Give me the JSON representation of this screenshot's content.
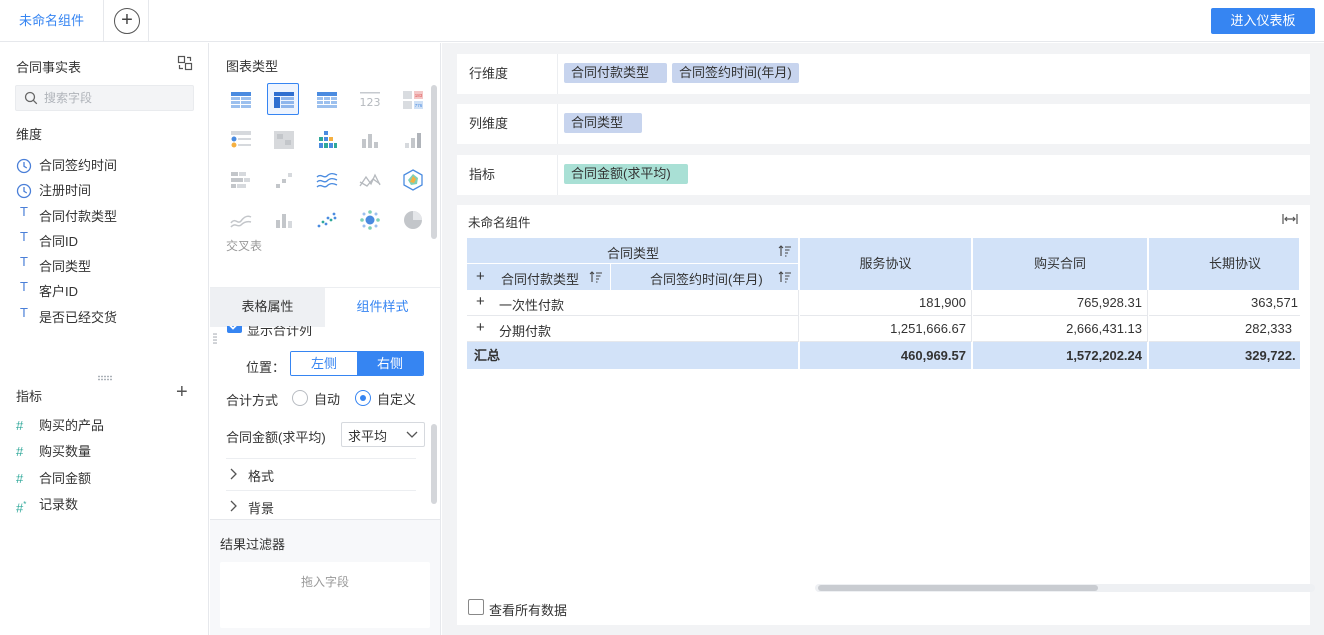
{
  "topbar": {
    "active_tab": "未命名组件",
    "add_tab": "+",
    "enter_dashboard": "进入仪表板"
  },
  "left_panel": {
    "dataset_title": "合同事实表",
    "search_placeholder": "搜索字段",
    "dimension_title": "维度",
    "dimensions": [
      {
        "icon": "clock-icon",
        "label": "合同签约时间"
      },
      {
        "icon": "clock-icon",
        "label": "注册时间"
      },
      {
        "icon": "text-type-icon",
        "label": "合同付款类型"
      },
      {
        "icon": "text-type-icon",
        "label": "合同ID"
      },
      {
        "icon": "text-type-icon",
        "label": "合同类型"
      },
      {
        "icon": "text-type-icon",
        "label": "客户ID"
      },
      {
        "icon": "text-type-icon",
        "label": "是否已经交货"
      }
    ],
    "metric_title": "指标",
    "metric_add": "+",
    "metrics": [
      {
        "icon": "hash-icon",
        "label": "购买的产品"
      },
      {
        "icon": "hash-icon",
        "label": "购买数量"
      },
      {
        "icon": "hash-icon",
        "label": "合同金额"
      },
      {
        "icon": "record-count-icon",
        "label": "记录数"
      }
    ]
  },
  "middle_panel": {
    "chart_type_title": "图表类型",
    "chart_types": [
      "detail-table-icon",
      "cross-table-icon",
      "grouped-table-icon",
      "kpi-number-icon",
      "colored-kpi-icon",
      "dot-matrix-icon",
      "heatmap-icon",
      "multi-bar-icon",
      "bar-chart-icon",
      "gradient-bar-icon",
      "stacked-bar-icon",
      "scatter-bar-icon",
      "area-line-icon",
      "line-chart-icon",
      "radar-chart-icon",
      "stream-chart-icon",
      "column-chart-icon",
      "scatter-plot-icon",
      "bubble-chart-icon",
      "pie-chart-icon"
    ],
    "selected_chart_type_index": 1,
    "selected_chart_type_name": "交叉表",
    "tabs": {
      "table_attrs": "表格属性",
      "component_style": "组件样式"
    },
    "cut_off_option": "显示合计列",
    "position_label": "位置：",
    "position_left": "左侧",
    "position_right": "右侧",
    "calc_label": "合计方式",
    "calc_auto": "自动",
    "calc_custom": "自定义",
    "amount_label": "合同金额(求平均)",
    "amount_value": "求平均",
    "format_label": "格式",
    "background_label": "背景",
    "filter_title": "结果过滤器",
    "filter_placeholder": "拖入字段"
  },
  "right_panel": {
    "row_dim_label": "行维度",
    "row_dims": [
      "合同付款类型",
      "合同签约时间(年月)"
    ],
    "col_dim_label": "列维度",
    "col_dims": [
      "合同类型"
    ],
    "metric_label": "指标",
    "metrics": [
      "合同金额(求平均)"
    ],
    "widget_title": "未命名组件",
    "see_all": "查看所有数据",
    "table": {
      "col_header": "合同类型",
      "row_header_1": "合同付款类型",
      "row_header_2": "合同签约时间(年月)",
      "expand_mark": "+",
      "columns": [
        "服务协议",
        "购买合同",
        "长期协议"
      ],
      "rows": [
        {
          "label": "一次性付款",
          "values": [
            "181,900",
            "765,928.31",
            "363,571"
          ]
        },
        {
          "label": "分期付款",
          "values": [
            "1,251,666.67",
            "2,666,431.13",
            "282,333"
          ]
        }
      ],
      "total": {
        "label": "汇总",
        "values": [
          "460,969.57",
          "1,572,202.24",
          "329,722."
        ]
      }
    }
  }
}
